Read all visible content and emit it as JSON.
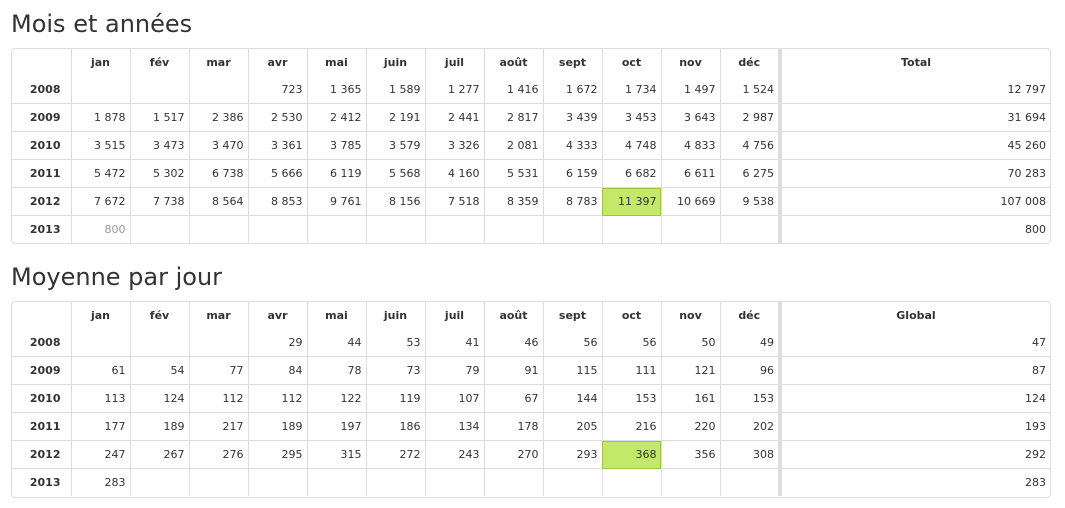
{
  "section1": {
    "title": "Mois et années",
    "header": [
      "",
      "jan",
      "fév",
      "mar",
      "avr",
      "mai",
      "juin",
      "juil",
      "août",
      "sept",
      "oct",
      "nov",
      "déc",
      "Total"
    ],
    "rows": [
      {
        "year": "2008",
        "cells": [
          "",
          "",
          "",
          "723",
          "1 365",
          "1 589",
          "1 277",
          "1 416",
          "1 672",
          "1 734",
          "1 497",
          "1 524"
        ],
        "total": "12 797"
      },
      {
        "year": "2009",
        "cells": [
          "1 878",
          "1 517",
          "2 386",
          "2 530",
          "2 412",
          "2 191",
          "2 441",
          "2 817",
          "3 439",
          "3 453",
          "3 643",
          "2 987"
        ],
        "total": "31 694"
      },
      {
        "year": "2010",
        "cells": [
          "3 515",
          "3 473",
          "3 470",
          "3 361",
          "3 785",
          "3 579",
          "3 326",
          "2 081",
          "4 333",
          "4 748",
          "4 833",
          "4 756"
        ],
        "total": "45 260"
      },
      {
        "year": "2011",
        "cells": [
          "5 472",
          "5 302",
          "6 738",
          "5 666",
          "6 119",
          "5 568",
          "4 160",
          "5 531",
          "6 159",
          "6 682",
          "6 611",
          "6 275"
        ],
        "total": "70 283"
      },
      {
        "year": "2012",
        "cells": [
          "7 672",
          "7 738",
          "8 564",
          "8 853",
          "9 761",
          "8 156",
          "7 518",
          "8 359",
          "8 783",
          "11 397",
          "10 669",
          "9 538"
        ],
        "total": "107 008"
      },
      {
        "year": "2013",
        "cells": [
          "800",
          "",
          "",
          "",
          "",
          "",
          "",
          "",
          "",
          "",
          "",
          ""
        ],
        "total": "800"
      }
    ]
  },
  "section2": {
    "title": "Moyenne par jour",
    "header": [
      "",
      "jan",
      "fév",
      "mar",
      "avr",
      "mai",
      "juin",
      "juil",
      "août",
      "sept",
      "oct",
      "nov",
      "déc",
      "Global"
    ],
    "rows": [
      {
        "year": "2008",
        "cells": [
          "",
          "",
          "",
          "29",
          "44",
          "53",
          "41",
          "46",
          "56",
          "56",
          "50",
          "49"
        ],
        "total": "47"
      },
      {
        "year": "2009",
        "cells": [
          "61",
          "54",
          "77",
          "84",
          "78",
          "73",
          "79",
          "91",
          "115",
          "111",
          "121",
          "96"
        ],
        "total": "87"
      },
      {
        "year": "2010",
        "cells": [
          "113",
          "124",
          "112",
          "112",
          "122",
          "119",
          "107",
          "67",
          "144",
          "153",
          "161",
          "153"
        ],
        "total": "124"
      },
      {
        "year": "2011",
        "cells": [
          "177",
          "189",
          "217",
          "189",
          "197",
          "186",
          "134",
          "178",
          "205",
          "216",
          "220",
          "202"
        ],
        "total": "193"
      },
      {
        "year": "2012",
        "cells": [
          "247",
          "267",
          "276",
          "295",
          "315",
          "272",
          "243",
          "270",
          "293",
          "368",
          "356",
          "308"
        ],
        "total": "292"
      },
      {
        "year": "2013",
        "cells": [
          "283",
          "",
          "",
          "",
          "",
          "",
          "",
          "",
          "",
          "",
          "",
          ""
        ],
        "total": "283"
      }
    ]
  },
  "colors": {
    "highlight": "#c4e86a",
    "border": "#dddddd",
    "muted_text": "#999999"
  }
}
